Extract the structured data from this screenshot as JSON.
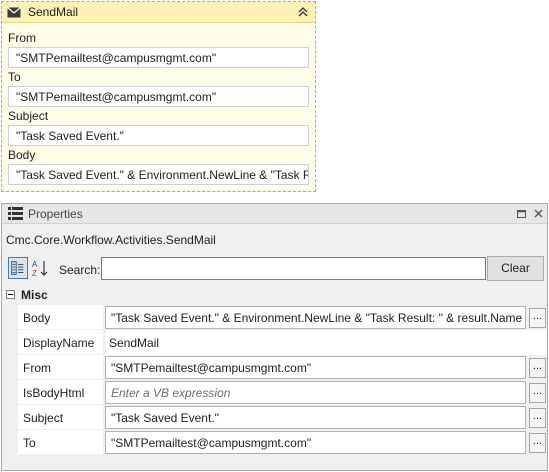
{
  "activity": {
    "title": "SendMail",
    "icons": {
      "activity": "envelope-icon",
      "collapse": "double-chevron-up-icon"
    },
    "fields": [
      {
        "label": "From",
        "value": "\"SMTPemailtest@campusmgmt.com\""
      },
      {
        "label": "To",
        "value": "\"SMTPemailtest@campusmgmt.com\""
      },
      {
        "label": "Subject",
        "value": "\"Task Saved Event.\""
      },
      {
        "label": "Body",
        "value": "\"Task Saved Event.\" & Environment.NewLine & \"Task R"
      }
    ]
  },
  "properties": {
    "title": "Properties",
    "type_name": "Cmc.Core.Workflow.Activities.SendMail",
    "icons": {
      "panel": "properties-icon",
      "restore": "restore-icon",
      "close": "close-icon",
      "categorized": "categorized-view-icon",
      "alphabetical": "alphabetical-sort-icon"
    },
    "search": {
      "label": "Search:",
      "value": "",
      "clear_label": "Clear"
    },
    "category": "Misc",
    "rows": [
      {
        "name": "Body",
        "value": "\"Task Saved Event.\" & Environment.NewLine & \"Task Result: \" & result.Name",
        "editable": true
      },
      {
        "name": "DisplayName",
        "value": "SendMail",
        "editable": false
      },
      {
        "name": "From",
        "value": "\"SMTPemailtest@campusmgmt.com\"",
        "editable": true
      },
      {
        "name": "IsBodyHtml",
        "value": "Enter a VB expression",
        "editable": true,
        "placeholder": true
      },
      {
        "name": "Subject",
        "value": "\"Task Saved Event.\"",
        "editable": true
      },
      {
        "name": "To",
        "value": "\"SMTPemailtest@campusmgmt.com\"",
        "editable": true
      }
    ],
    "ellipsis_label": "..."
  }
}
